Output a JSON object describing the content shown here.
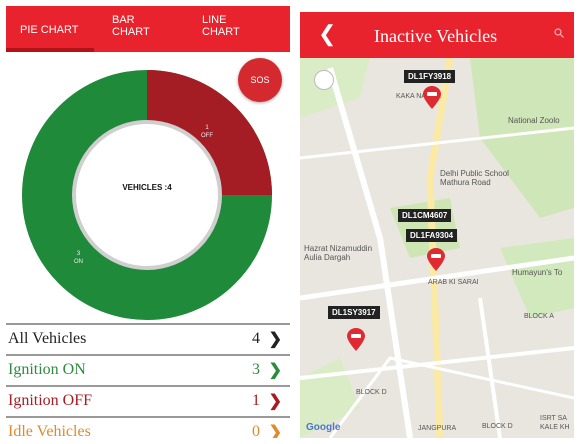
{
  "left": {
    "tabs": [
      {
        "label": "PIE CHART"
      },
      {
        "label": "BAR CHART"
      },
      {
        "label": "LINE CHART"
      }
    ],
    "sos_label": "SOS",
    "center_label": "VEHICLES :4",
    "segments": [
      {
        "label": "OFF",
        "count": "1",
        "color": "#a51d24"
      },
      {
        "label": "ON",
        "count": "3",
        "color": "#1f8a3a"
      }
    ],
    "list": [
      {
        "label": "All Vehicles",
        "count": "4",
        "color": "#222222"
      },
      {
        "label": "Ignition ON",
        "count": "3",
        "color": "#2e8b3d"
      },
      {
        "label": "Ignition OFF",
        "count": "1",
        "color": "#a51d24"
      },
      {
        "label": "Idle Vehicles",
        "count": "0",
        "color": "#e08a2a"
      }
    ]
  },
  "right": {
    "title": "Inactive Vehicles",
    "back_icon": "chevron-left-icon",
    "markers": [
      {
        "label": "DL1FY3918"
      },
      {
        "label": "DL1CM4607"
      },
      {
        "label": "DL1FA9304"
      },
      {
        "label": "DL1SY3917"
      }
    ],
    "places": {
      "kaka": "KAKA NAGAR",
      "national_zoo": "National Zoolo",
      "dps": "Delhi Public School\nMathura Road",
      "nizamuddin": "Hazrat Nizamuddin\nAulia Dargah",
      "humayun": "Humayun's To",
      "arab": "ARAB KI SARAI",
      "block_a": "BLOCK A",
      "block_d": "BLOCK D",
      "jangpura": "JANGPURA",
      "block_d2": "BLOCK D",
      "isrt": "ISRT SA\nKALE KH"
    },
    "google": "Google"
  },
  "colors": {
    "accent": "#e8232e"
  }
}
